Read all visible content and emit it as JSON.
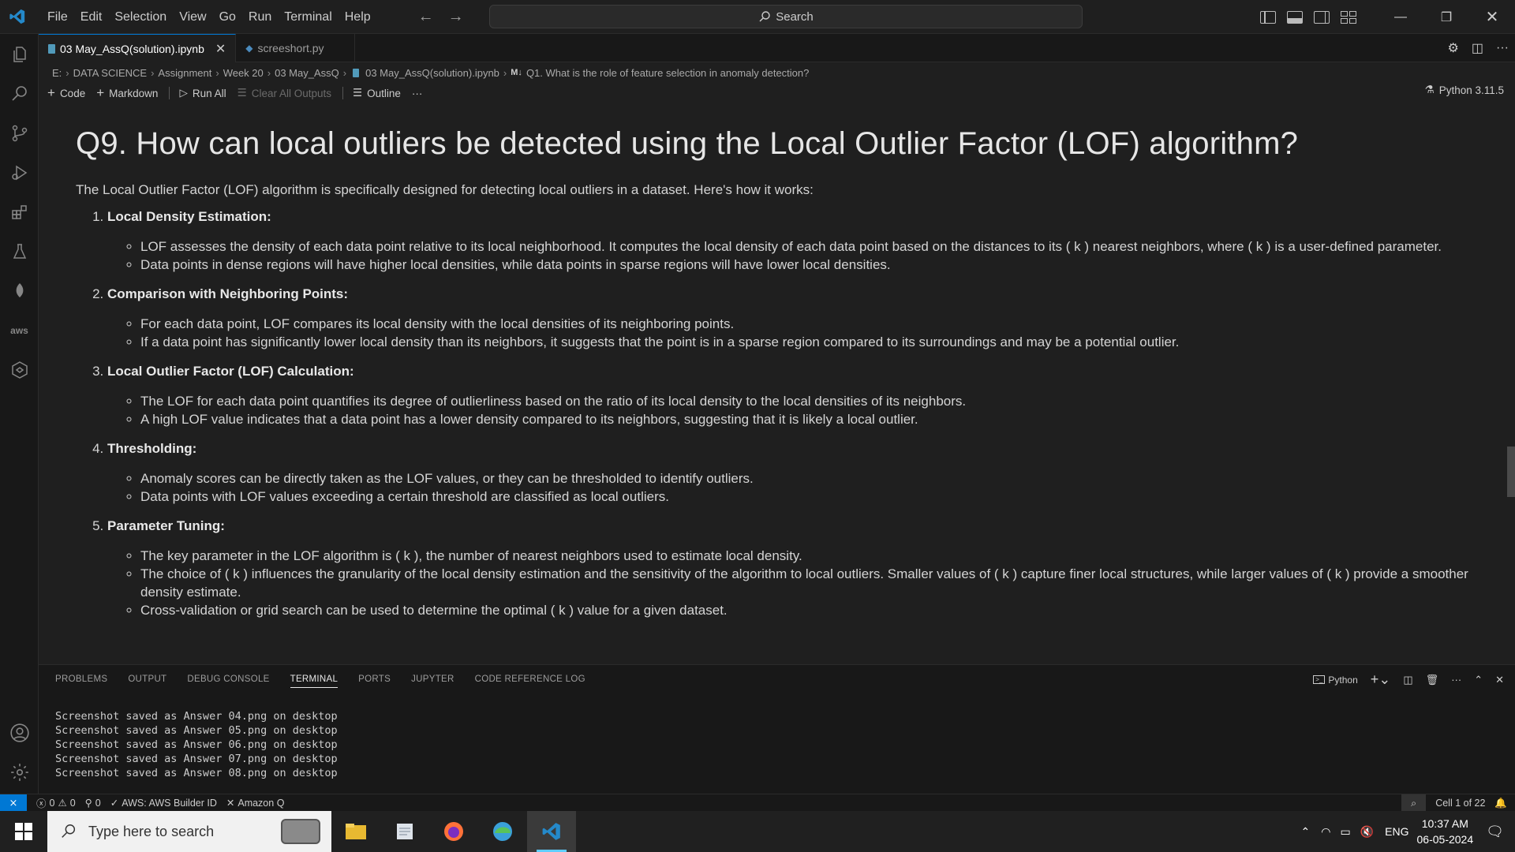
{
  "menu": [
    "File",
    "Edit",
    "Selection",
    "View",
    "Go",
    "Run",
    "Terminal",
    "Help"
  ],
  "search": {
    "label": "Search"
  },
  "tabs": [
    {
      "label": "03 May_AssQ(solution).ipynb",
      "active": true
    },
    {
      "label": "screeshort.py",
      "active": false
    }
  ],
  "breadcrumb": [
    "E:",
    "DATA SCIENCE",
    "Assignment",
    "Week 20",
    "03 May_AssQ",
    "03 May_AssQ(solution).ipynb",
    "Q1. What is the role of feature selection in anomaly detection?"
  ],
  "breadcrumb_md_badge": "M↓",
  "toolbar": {
    "code": "Code",
    "markdown": "Markdown",
    "run_all": "Run All",
    "clear_all": "Clear All Outputs",
    "outline": "Outline",
    "more": "···",
    "kernel": "Python 3.11.5"
  },
  "content": {
    "heading": "Q9. How can local outliers be detected using the Local Outlier Factor (LOF) algorithm?",
    "intro": "The Local Outlier Factor (LOF) algorithm is specifically designed for detecting local outliers in a dataset. Here's how it works:",
    "sections": [
      {
        "title": "Local Density Estimation:",
        "bullets": [
          "LOF assesses the density of each data point relative to its local neighborhood. It computes the local density of each data point based on the distances to its ( k ) nearest neighbors, where ( k ) is a user-defined parameter.",
          "Data points in dense regions will have higher local densities, while data points in sparse regions will have lower local densities."
        ]
      },
      {
        "title": "Comparison with Neighboring Points:",
        "bullets": [
          "For each data point, LOF compares its local density with the local densities of its neighboring points.",
          "If a data point has significantly lower local density than its neighbors, it suggests that the point is in a sparse region compared to its surroundings and may be a potential outlier."
        ]
      },
      {
        "title": "Local Outlier Factor (LOF) Calculation:",
        "bullets": [
          "The LOF for each data point quantifies its degree of outlierliness based on the ratio of its local density to the local densities of its neighbors.",
          "A high LOF value indicates that a data point has a lower density compared to its neighbors, suggesting that it is likely a local outlier."
        ]
      },
      {
        "title": "Thresholding:",
        "bullets": [
          "Anomaly scores can be directly taken as the LOF values, or they can be thresholded to identify outliers.",
          "Data points with LOF values exceeding a certain threshold are classified as local outliers."
        ]
      },
      {
        "title": "Parameter Tuning:",
        "bullets": [
          "The key parameter in the LOF algorithm is ( k ), the number of nearest neighbors used to estimate local density.",
          "The choice of ( k ) influences the granularity of the local density estimation and the sensitivity of the algorithm to local outliers. Smaller values of ( k ) capture finer local structures, while larger values of ( k ) provide a smoother density estimate.",
          "Cross-validation or grid search can be used to determine the optimal ( k ) value for a given dataset."
        ]
      }
    ]
  },
  "panel": {
    "tabs": [
      "PROBLEMS",
      "OUTPUT",
      "DEBUG CONSOLE",
      "TERMINAL",
      "PORTS",
      "JUPYTER",
      "CODE REFERENCE LOG"
    ],
    "active_tab": "TERMINAL",
    "shell": "Python",
    "terminal_lines": [
      "Screenshot saved as Answer 04.png on desktop",
      "Screenshot saved as Answer 05.png on desktop",
      "Screenshot saved as Answer 06.png on desktop",
      "Screenshot saved as Answer 07.png on desktop",
      "Screenshot saved as Answer 08.png on desktop"
    ]
  },
  "status": {
    "errors": "0",
    "warnings": "0",
    "ports": "0",
    "aws": "AWS: AWS Builder ID",
    "amazonq": "Amazon Q",
    "cell": "Cell 1 of 22"
  },
  "taskbar": {
    "search_placeholder": "Type here to search",
    "lang": "ENG",
    "time": "10:37 AM",
    "date": "06-05-2024"
  },
  "colors": {
    "accent": "#0078d4",
    "background": "#1f1f1f",
    "sidebar": "#181818"
  }
}
